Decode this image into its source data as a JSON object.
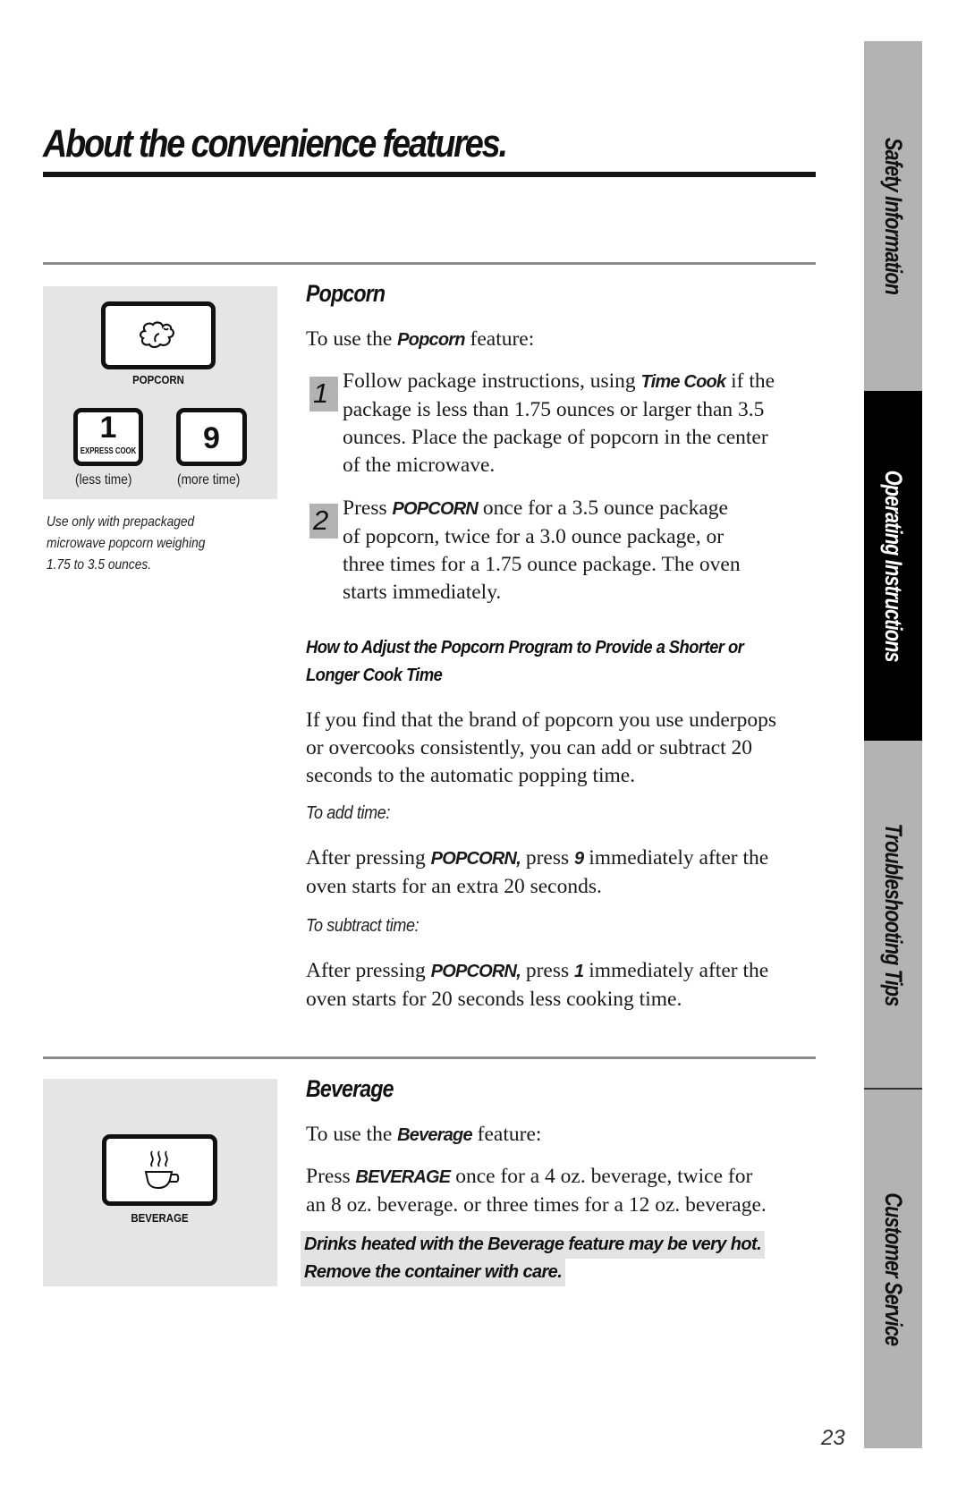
{
  "page": {
    "title": "About the convenience features.",
    "page_number": "23"
  },
  "popcorn": {
    "heading": "Popcorn",
    "panel": {
      "main_key_label": "POPCORN",
      "main_key_icon": "popcorn-icon",
      "less_key": {
        "number": "1",
        "sublabel": "EXPRESS COOK",
        "caption": "(less time)"
      },
      "more_key": {
        "number": "9",
        "caption": "(more time)"
      },
      "note_lines": [
        "Use only with prepackaged",
        "microwave popcorn weighing",
        "1.75 to 3.5 ounces."
      ]
    },
    "intro": {
      "pre": "To use the ",
      "kw": "Popcorn",
      "post": " feature:"
    },
    "steps": [
      {
        "number": "1",
        "lines": [
          {
            "pre": "Follow package instructions, using ",
            "kw": "Time Cook",
            "post": " if the"
          },
          {
            "pre": "package is less than 1.75 ounces or larger than 3.5"
          },
          {
            "pre": "ounces. Place the package of popcorn in the center"
          },
          {
            "pre": "of the microwave."
          }
        ]
      },
      {
        "number": "2",
        "lines": [
          {
            "pre": "Press ",
            "kw": "POPCORN",
            "post": " once for a 3.5 ounce package"
          },
          {
            "pre": "of popcorn, twice for a 3.0 ounce package, or"
          },
          {
            "pre": "three times for a 1.75 ounce package. The oven"
          },
          {
            "pre": "starts immediately."
          }
        ]
      }
    ],
    "adjust": {
      "heading_lines": [
        "How to Adjust the Popcorn Program to Provide a Shorter or",
        "Longer Cook Time"
      ],
      "body_lines": [
        "If you find that the brand of popcorn you use underpops",
        "or overcooks consistently, you can add or subtract 20",
        "seconds to the automatic popping time."
      ],
      "add_label": "To add time:",
      "add_lines": [
        {
          "pre": "After pressing ",
          "kw": "POPCORN,",
          "mid": " press ",
          "kw2": "9",
          "post": " immediately after the"
        },
        {
          "pre": "oven starts for an extra 20 seconds."
        }
      ],
      "subtract_label": "To subtract time:",
      "subtract_lines": [
        {
          "pre": "After pressing ",
          "kw": "POPCORN,",
          "mid": " press ",
          "kw2": "1",
          "post": " immediately after the"
        },
        {
          "pre": "oven starts for 20 seconds less cooking time."
        }
      ]
    }
  },
  "beverage": {
    "heading": "Beverage",
    "panel": {
      "key_label": "BEVERAGE",
      "key_icon": "coffee-cup-icon"
    },
    "intro": {
      "pre": "To use the ",
      "kw": "Beverage",
      "post": " feature:"
    },
    "lines": [
      {
        "pre": "Press ",
        "kw": "BEVERAGE",
        "post": "  once for a 4 oz. beverage, twice for"
      },
      {
        "pre": "an 8 oz. beverage. or three times for a 12 oz. beverage."
      }
    ],
    "warning_lines": [
      "Drinks heated with the Beverage feature may be very hot.",
      "Remove the container with care."
    ]
  },
  "sidebar": {
    "tabs": [
      {
        "label": "Safety Information",
        "active": false
      },
      {
        "label": "Operating Instructions",
        "active": true
      },
      {
        "label": "Troubleshooting Tips",
        "active": false
      },
      {
        "label": "Customer Service",
        "active": false
      }
    ]
  },
  "colors": {
    "panel_gray": "#e5e5e5",
    "tab_gray": "#b3b3b3",
    "tab_active": "#000000",
    "rule_gray": "#8c8c8c"
  }
}
